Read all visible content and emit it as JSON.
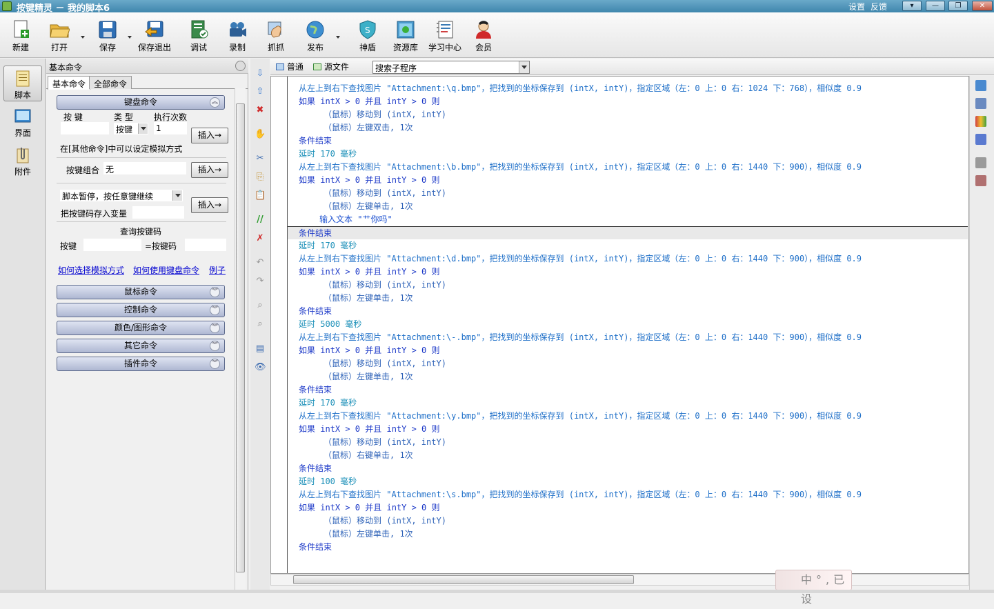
{
  "window": {
    "title": "按键精灵 － 我的脚本6",
    "settings_link": "设置",
    "feedback_link": "反馈",
    "btn_menu": "▾",
    "btn_min": "—",
    "btn_restore": "❐",
    "btn_close": "✕"
  },
  "toolbar": {
    "new": "新建",
    "open": "打开",
    "save": "保存",
    "save_exit": "保存退出",
    "debug": "调试",
    "record": "录制",
    "grab": "抓抓",
    "publish": "发布",
    "shield": "神盾",
    "resources": "资源库",
    "learn": "学习中心",
    "member": "会员"
  },
  "sidebar": {
    "script": "脚本",
    "ui": "界面",
    "attachment": "附件"
  },
  "cmd_panel": {
    "header": "基本命令",
    "tab_basic": "基本命令",
    "tab_all": "全部命令",
    "keyboard_section": "键盘命令",
    "col_key": "按 键",
    "col_type": "类 型",
    "col_times": "执行次数",
    "type_value": "按键",
    "times_value": "1",
    "insert": "插入→",
    "sim_note": "在[其他命令]中可以设定模拟方式",
    "combo_label": "按键组合",
    "combo_value": "无",
    "pause_option": "脚本暂停，按任意键继续",
    "save_key_var": "把按键码存入变量",
    "query_title": "查询按键码",
    "query_key": "按键",
    "query_code": "=按键码",
    "link_sim": "如何选择模拟方式",
    "link_use": "如何使用键盘命令",
    "link_example": "例子",
    "mouse_section": "鼠标命令",
    "control_section": "控制命令",
    "color_section": "颜色/图形命令",
    "other_section": "其它命令",
    "plugin_section": "插件命令"
  },
  "editor_tabs": {
    "normal": "普通",
    "source": "源文件",
    "search": "搜索子程序"
  },
  "code": [
    {
      "t": "从左上到右下查找图片 \"Attachment:\\q.bmp\"，把找到的坐标保存到 (intX, intY)，指定区域（左：0 上：0 右：1024 下：768），相似度 0.9",
      "k": "find",
      "i": 0
    },
    {
      "t": "如果 intX > 0 并且 intY > 0 则",
      "k": "if",
      "i": 0
    },
    {
      "t": "（鼠标）移动到 (intX, intY)",
      "k": "mouse",
      "i": 1
    },
    {
      "t": "（鼠标）左键双击, 1次",
      "k": "mouse",
      "i": 1
    },
    {
      "t": "条件结束",
      "k": "end",
      "i": 0
    },
    {
      "t": "延时 170 毫秒",
      "k": "delay",
      "i": 0
    },
    {
      "t": "从左上到右下查找图片 \"Attachment:\\b.bmp\"，把找到的坐标保存到 (intX, intY)，指定区域（左：0 上：0 右：1440 下：900），相似度 0.9",
      "k": "find",
      "i": 0
    },
    {
      "t": "如果 intX > 0 并且 intY > 0 则",
      "k": "if",
      "i": 0
    },
    {
      "t": "（鼠标）移动到 (intX, intY)",
      "k": "mouse",
      "i": 1
    },
    {
      "t": "（鼠标）左键单击, 1次",
      "k": "mouse",
      "i": 1
    },
    {
      "t": "输入文本 \"艹你吗\"",
      "k": "key",
      "i": 2
    },
    {
      "t": "条件结束",
      "k": "end",
      "i": 0,
      "sel": true
    },
    {
      "t": "延时 170 毫秒",
      "k": "delay",
      "i": 0
    },
    {
      "t": "从左上到右下查找图片 \"Attachment:\\d.bmp\"，把找到的坐标保存到 (intX, intY)，指定区域（左：0 上：0 右：1440 下：900），相似度 0.9",
      "k": "find",
      "i": 0
    },
    {
      "t": "如果 intX > 0 并且 intY > 0 则",
      "k": "if",
      "i": 0
    },
    {
      "t": "（鼠标）移动到 (intX, intY)",
      "k": "mouse",
      "i": 1
    },
    {
      "t": "（鼠标）左键单击, 1次",
      "k": "mouse",
      "i": 1
    },
    {
      "t": "条件结束",
      "k": "end",
      "i": 0
    },
    {
      "t": "延时 5000 毫秒",
      "k": "delay",
      "i": 0
    },
    {
      "t": "从左上到右下查找图片 \"Attachment:\\-.bmp\"，把找到的坐标保存到 (intX, intY)，指定区域（左：0 上：0 右：1440 下：900），相似度 0.9",
      "k": "find",
      "i": 0
    },
    {
      "t": "如果 intX > 0 并且 intY > 0 则",
      "k": "if",
      "i": 0
    },
    {
      "t": "（鼠标）移动到 (intX, intY)",
      "k": "mouse",
      "i": 1
    },
    {
      "t": "（鼠标）左键单击, 1次",
      "k": "mouse",
      "i": 1
    },
    {
      "t": "条件结束",
      "k": "end",
      "i": 0
    },
    {
      "t": "延时 170 毫秒",
      "k": "delay",
      "i": 0
    },
    {
      "t": "从左上到右下查找图片 \"Attachment:\\y.bmp\"，把找到的坐标保存到 (intX, intY)，指定区域（左：0 上：0 右：1440 下：900），相似度 0.9",
      "k": "find",
      "i": 0
    },
    {
      "t": "如果 intX > 0 并且 intY > 0 则",
      "k": "if",
      "i": 0
    },
    {
      "t": "（鼠标）移动到 (intX, intY)",
      "k": "mouse",
      "i": 1
    },
    {
      "t": "（鼠标）右键单击, 1次",
      "k": "mouse",
      "i": 1
    },
    {
      "t": "条件结束",
      "k": "end",
      "i": 0
    },
    {
      "t": "延时 100 毫秒",
      "k": "delay",
      "i": 0
    },
    {
      "t": "从左上到右下查找图片 \"Attachment:\\s.bmp\"，把找到的坐标保存到 (intX, intY)，指定区域（左：0 上：0 右：1440 下：900），相似度 0.9",
      "k": "find",
      "i": 0
    },
    {
      "t": "如果 intX > 0 并且 intY > 0 则",
      "k": "if",
      "i": 0
    },
    {
      "t": "（鼠标）移动到 (intX, intY)",
      "k": "mouse",
      "i": 1
    },
    {
      "t": "（鼠标）左键单击, 1次",
      "k": "mouse",
      "i": 1
    },
    {
      "t": "条件结束",
      "k": "end",
      "i": 0
    }
  ],
  "ime": {
    "text": "中°,已设"
  }
}
